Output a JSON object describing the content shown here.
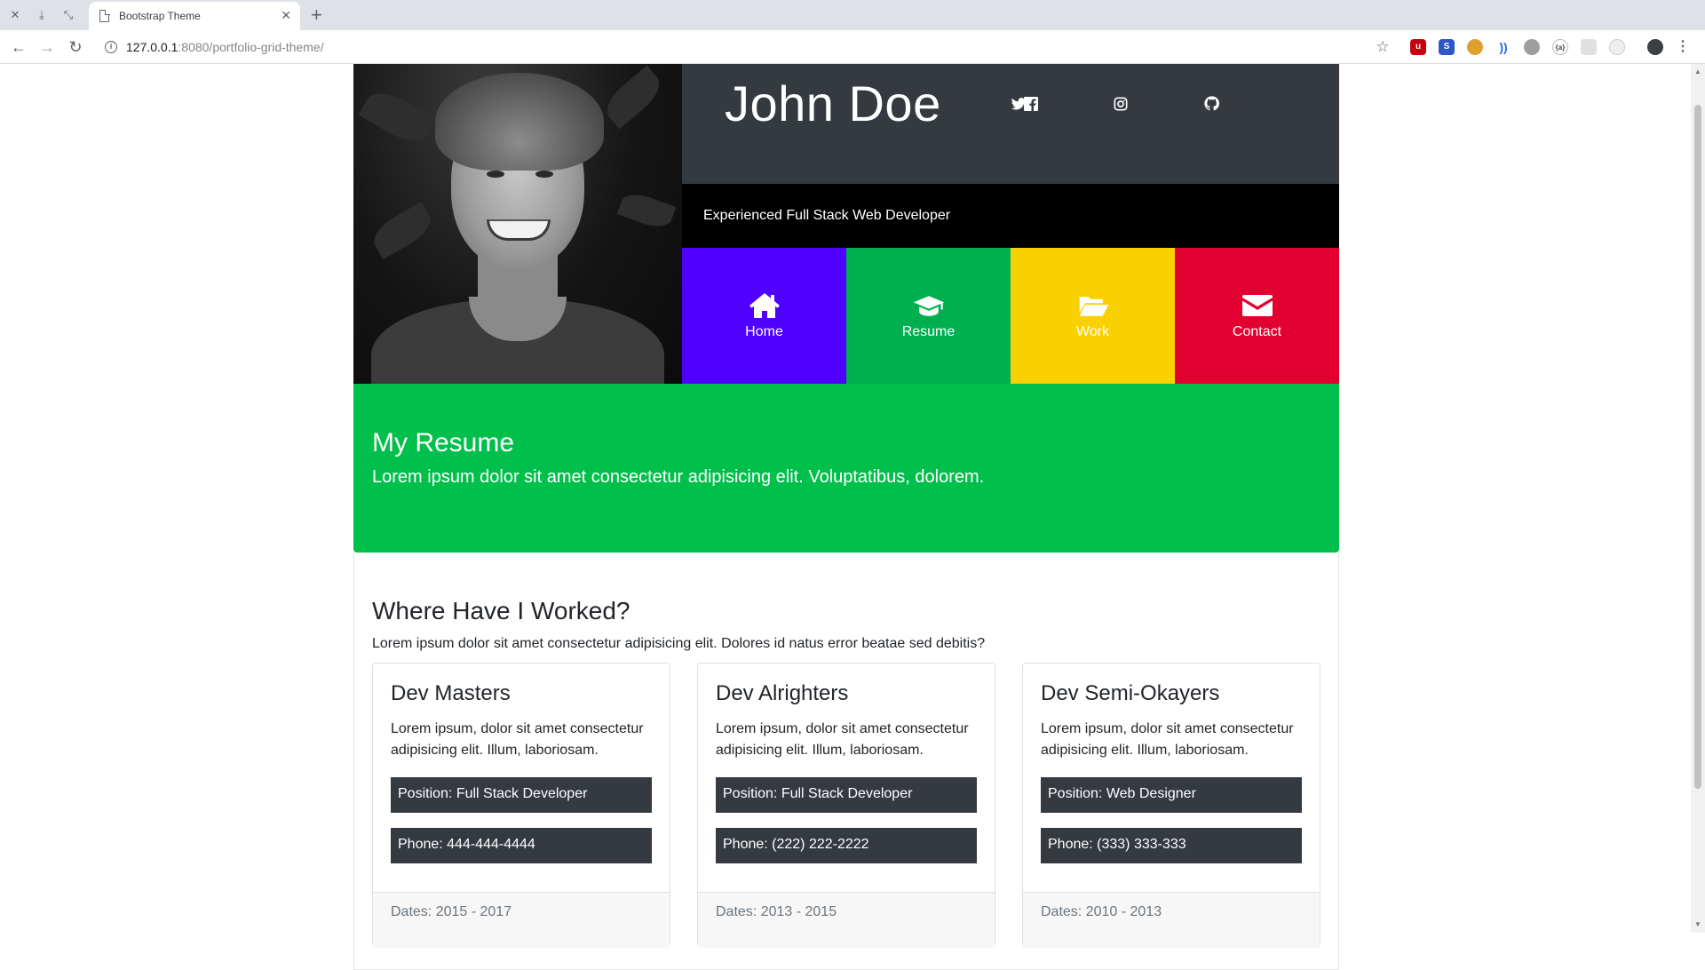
{
  "browser": {
    "tab_title": "Bootstrap Theme",
    "url_host": "127.0.0.1",
    "url_rest": ":8080/portfolio-grid-theme/"
  },
  "header": {
    "name": "John Doe",
    "tagline": "Experienced Full Stack Web Developer",
    "social": [
      "twitter-icon",
      "facebook-icon",
      "instagram-icon",
      "github-icon"
    ]
  },
  "nav": {
    "tiles": [
      {
        "label": "Home",
        "icon": "home-icon",
        "color": "#5000ff"
      },
      {
        "label": "Resume",
        "icon": "graduation-cap-icon",
        "color": "#00b050"
      },
      {
        "label": "Work",
        "icon": "folder-open-icon",
        "color": "#f9d000"
      },
      {
        "label": "Contact",
        "icon": "envelope-icon",
        "color": "#e1002f"
      }
    ]
  },
  "resume": {
    "title": "My Resume",
    "lead": "Lorem ipsum dolor sit amet consectetur adipisicing elit. Voluptatibus, dolorem.",
    "color": "#00c04b"
  },
  "worked": {
    "title": "Where Have I Worked?",
    "text": "Lorem ipsum dolor sit amet consectetur adipisicing elit. Dolores id natus error beatae sed debitis?",
    "cards": [
      {
        "title": "Dev Masters",
        "text": "Lorem ipsum, dolor sit amet consectetur adipisicing elit. Illum, laboriosam.",
        "position": "Position: Full Stack Developer",
        "phone": "Phone: 444-444-4444",
        "dates": "Dates: 2015 - 2017"
      },
      {
        "title": "Dev Alrighters",
        "text": "Lorem ipsum, dolor sit amet consectetur adipisicing elit. Illum, laboriosam.",
        "position": "Position: Full Stack Developer",
        "phone": "Phone: (222) 222-2222",
        "dates": "Dates: 2013 - 2015"
      },
      {
        "title": "Dev Semi-Okayers",
        "text": "Lorem ipsum, dolor sit amet consectetur adipisicing elit. Illum, laboriosam.",
        "position": "Position: Web Designer",
        "phone": "Phone: (333) 333-333",
        "dates": "Dates: 2010 - 2013"
      }
    ]
  }
}
